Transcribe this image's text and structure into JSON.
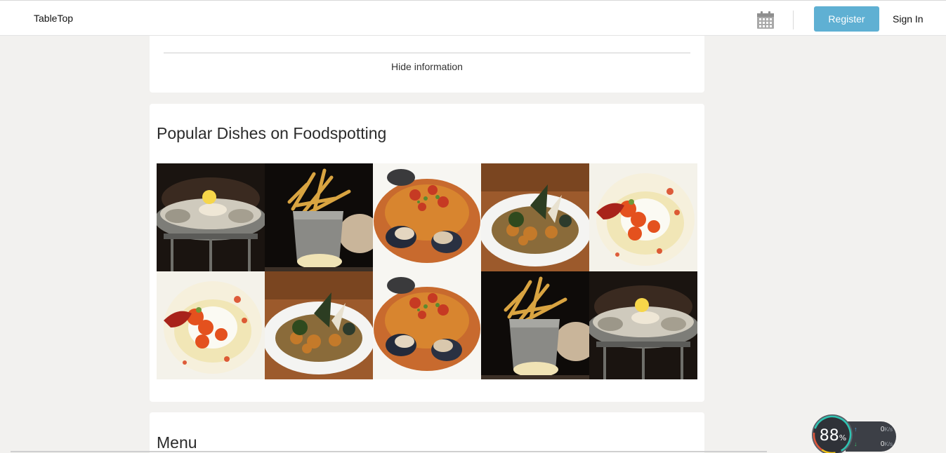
{
  "header": {
    "brand": "TableTop",
    "register_label": "Register",
    "signin_label": "Sign In",
    "accent_color": "#5fb0d3",
    "calendar_icon": "calendar-icon"
  },
  "info_card": {
    "hide_label": "Hide information"
  },
  "dishes": {
    "title": "Popular Dishes on Foodspotting",
    "items": [
      {
        "kind": "oysters"
      },
      {
        "kind": "fries"
      },
      {
        "kind": "seafood-pasta"
      },
      {
        "kind": "fish-plate"
      },
      {
        "kind": "tomato-burrata"
      },
      {
        "kind": "tomato-burrata"
      },
      {
        "kind": "fish-plate"
      },
      {
        "kind": "seafood-pasta"
      },
      {
        "kind": "fries"
      },
      {
        "kind": "oysters"
      }
    ]
  },
  "menu": {
    "title": "Menu"
  },
  "net_widget": {
    "percent": "88",
    "percent_sign": "%",
    "upload_value": "0",
    "download_value": "0",
    "unit": "K/s"
  }
}
